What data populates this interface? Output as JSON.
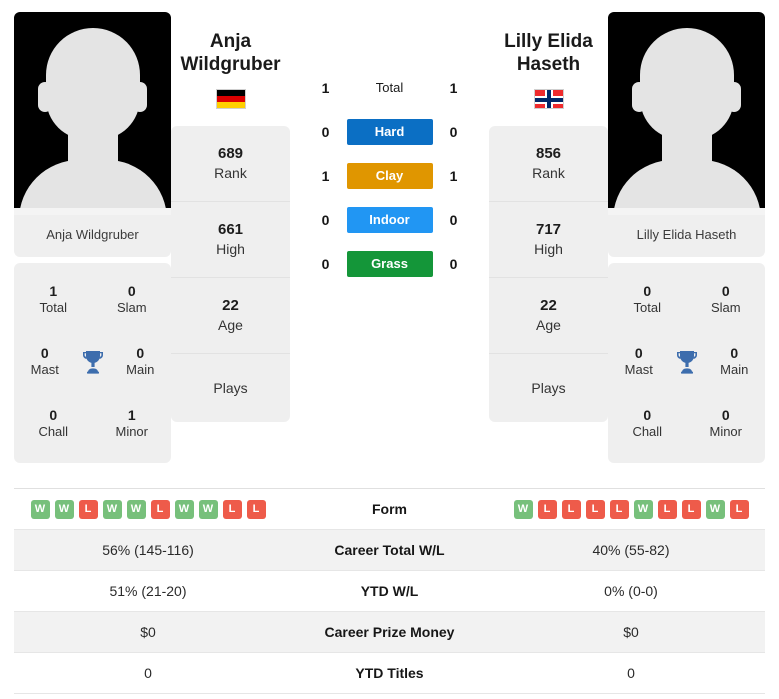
{
  "colors": {
    "hard": "#0b6fc4",
    "clay": "#e09600",
    "indoor": "#2196f3",
    "grass": "#149639",
    "win": "#77c07b",
    "loss": "#ee5b4a",
    "trophy": "#3d6dad",
    "card_bg": "#efefef"
  },
  "player_left": {
    "name": "Anja Wildgruber",
    "name_line1": "Anja",
    "name_line2": "Wildgruber",
    "country": "Germany",
    "flag_icon": "flag-germany-icon",
    "avatar_icon": "player-avatar-placeholder",
    "awards": [
      {
        "value": "1",
        "label": "Total"
      },
      {
        "value": "0",
        "label": "Slam"
      },
      {
        "value": "0",
        "label": "Mast"
      },
      {
        "value": "0",
        "label": "Main"
      },
      {
        "value": "0",
        "label": "Chall"
      },
      {
        "value": "1",
        "label": "Minor"
      }
    ],
    "stats": [
      {
        "value": "689",
        "label": "Rank"
      },
      {
        "value": "661",
        "label": "High"
      },
      {
        "value": "22",
        "label": "Age"
      },
      {
        "value": "",
        "label": "Plays"
      }
    ],
    "form": [
      "W",
      "W",
      "L",
      "W",
      "W",
      "L",
      "W",
      "W",
      "L",
      "L"
    ]
  },
  "player_right": {
    "name": "Lilly Elida Haseth",
    "name_line1": "Lilly Elida",
    "name_line2": "Haseth",
    "country": "Norway",
    "flag_icon": "flag-norway-icon",
    "avatar_icon": "player-avatar-placeholder",
    "awards": [
      {
        "value": "0",
        "label": "Total"
      },
      {
        "value": "0",
        "label": "Slam"
      },
      {
        "value": "0",
        "label": "Mast"
      },
      {
        "value": "0",
        "label": "Main"
      },
      {
        "value": "0",
        "label": "Chall"
      },
      {
        "value": "0",
        "label": "Minor"
      }
    ],
    "stats": [
      {
        "value": "856",
        "label": "Rank"
      },
      {
        "value": "717",
        "label": "High"
      },
      {
        "value": "22",
        "label": "Age"
      },
      {
        "value": "",
        "label": "Plays"
      }
    ],
    "form": [
      "W",
      "L",
      "L",
      "L",
      "L",
      "W",
      "L",
      "L",
      "W",
      "L"
    ]
  },
  "surfaces": [
    {
      "label": "Total",
      "left": "1",
      "right": "1",
      "style": "plain"
    },
    {
      "label": "Hard",
      "left": "0",
      "right": "0",
      "style": "hard"
    },
    {
      "label": "Clay",
      "left": "1",
      "right": "1",
      "style": "clay"
    },
    {
      "label": "Indoor",
      "left": "0",
      "right": "0",
      "style": "indoor"
    },
    {
      "label": "Grass",
      "left": "0",
      "right": "0",
      "style": "grass"
    }
  ],
  "table": {
    "form_label": "Form",
    "rows": [
      {
        "label": "Career Total W/L",
        "left": "56% (145-116)",
        "right": "40% (55-82)"
      },
      {
        "label": "YTD W/L",
        "left": "51% (21-20)",
        "right": "0% (0-0)"
      },
      {
        "label": "Career Prize Money",
        "left": "$0",
        "right": "$0"
      },
      {
        "label": "YTD Titles",
        "left": "0",
        "right": "0"
      }
    ]
  }
}
